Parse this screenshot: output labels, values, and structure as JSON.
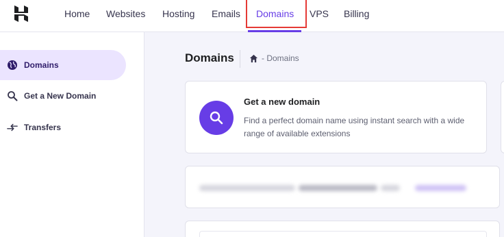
{
  "topnav": {
    "logo": "hostinger-logo-icon",
    "items": [
      {
        "label": "Home"
      },
      {
        "label": "Websites"
      },
      {
        "label": "Hosting"
      },
      {
        "label": "Emails"
      },
      {
        "label": "Domains",
        "active": true
      },
      {
        "label": "VPS"
      },
      {
        "label": "Billing"
      }
    ]
  },
  "sidebar": {
    "items": [
      {
        "label": "Domains",
        "icon": "globe-icon",
        "active": true
      },
      {
        "label": "Get a New Domain",
        "icon": "search-icon"
      },
      {
        "label": "Transfers",
        "icon": "transfer-arrows-icon"
      }
    ]
  },
  "main": {
    "title": "Domains",
    "breadcrumb": {
      "icon": "home-icon",
      "text": "- Domains"
    },
    "new_domain_card": {
      "icon": "search-icon",
      "title": "Get a new domain",
      "description": "Find a perfect domain name using instant search with a wide range of available extensions"
    }
  },
  "colors": {
    "accent": "#673de6",
    "highlight_box": "#e53935",
    "sidebar_active_bg": "#ebe4ff",
    "page_bg": "#f4f4fb"
  }
}
